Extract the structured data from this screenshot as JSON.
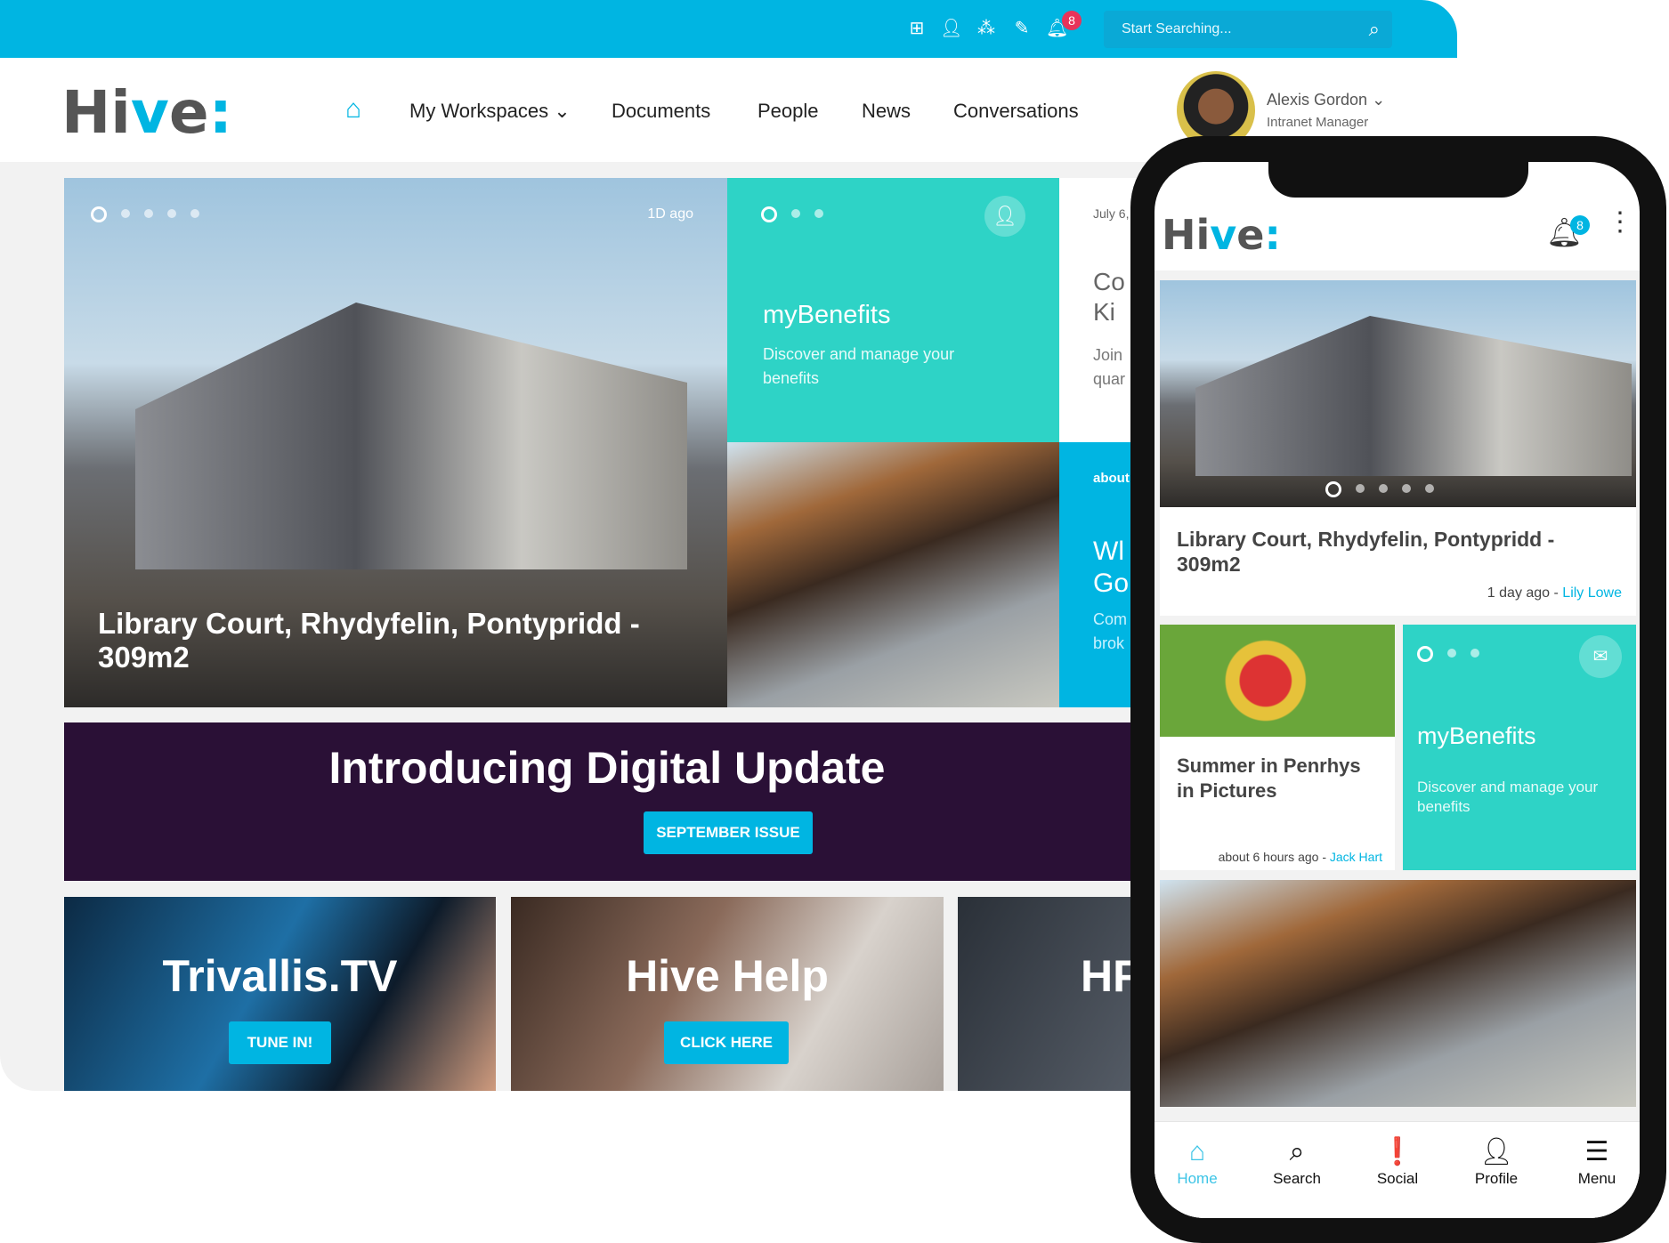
{
  "topbar": {
    "search_placeholder": "Start Searching...",
    "notification_count": "8",
    "accent": "#00b5e2"
  },
  "nav": {
    "logo": "Hive",
    "items": [
      "My Workspaces",
      "Documents",
      "People",
      "News",
      "Conversations"
    ],
    "user_name": "Alexis Gordon",
    "user_role": "Intranet Manager"
  },
  "hero": {
    "time": "1D ago",
    "title": "Library Court, Rhydyfelin, Pontypridd - 309m2"
  },
  "benefits": {
    "title": "myBenefits",
    "text": "Discover and manage your benefits",
    "color": "#2ed3c6"
  },
  "news_card": {
    "date": "July 6,",
    "title": "Co Ki",
    "text": "Join quar"
  },
  "blue_card": {
    "meta": "about",
    "title": "Wl Go",
    "text": "Com brok"
  },
  "banner": {
    "title": "Introducing Digital Update",
    "button": "SEPTEMBER ISSUE",
    "color": "#2a1036"
  },
  "tiles": [
    {
      "title": "Trivallis.TV",
      "button": "TUNE IN!"
    },
    {
      "title": "Hive Help",
      "button": "CLICK HERE"
    },
    {
      "title": "HF",
      "button": ""
    }
  ],
  "phone": {
    "logo": "Hive",
    "notification_count": "8",
    "hero_title": "Library Court, Rhydyfelin, Pontypridd - 309m2",
    "hero_time": "1 day ago - ",
    "hero_author": "Lily Lowe",
    "tile_title": "Summer in Penrhys in Pictures",
    "tile_time": "about 6 hours ago - ",
    "tile_author": "Jack Hart",
    "benefits_title": "myBenefits",
    "benefits_text": "Discover and manage your benefits",
    "bottom_nav": [
      "Home",
      "Search",
      "Social",
      "Profile",
      "Menu"
    ]
  }
}
